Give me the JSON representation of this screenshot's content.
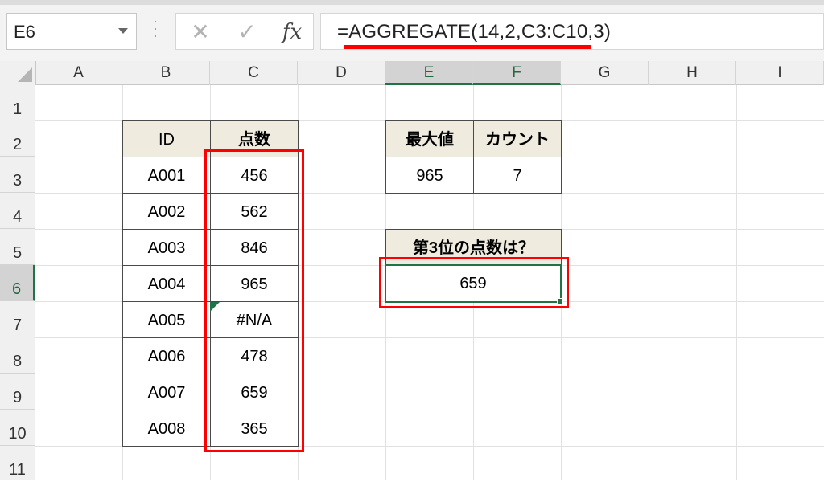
{
  "formula_bar": {
    "name_box": "E6",
    "cancel_glyph": "✕",
    "enter_glyph": "✓",
    "fx_label": "fx",
    "formula": "=AGGREGATE(14,2,C3:C10,3)"
  },
  "columns": [
    "A",
    "B",
    "C",
    "D",
    "E",
    "F",
    "G",
    "H",
    "I"
  ],
  "rows": [
    "1",
    "2",
    "3",
    "4",
    "5",
    "6",
    "7",
    "8",
    "9",
    "10",
    "11"
  ],
  "table1": {
    "headers": [
      "ID",
      "点数"
    ],
    "rows": [
      [
        "A001",
        "456"
      ],
      [
        "A002",
        "562"
      ],
      [
        "A003",
        "846"
      ],
      [
        "A004",
        "965"
      ],
      [
        "A005",
        "#N/A"
      ],
      [
        "A006",
        "478"
      ],
      [
        "A007",
        "659"
      ],
      [
        "A008",
        "365"
      ]
    ]
  },
  "table2": {
    "headers": [
      "最大値",
      "カウント"
    ],
    "values": [
      "965",
      "7"
    ]
  },
  "rank_box": {
    "label": "第3位の点数は？",
    "value": "659"
  },
  "colors": {
    "highlight": "#ff0000",
    "selection": "#217346",
    "header_fill": "#efebdf"
  }
}
